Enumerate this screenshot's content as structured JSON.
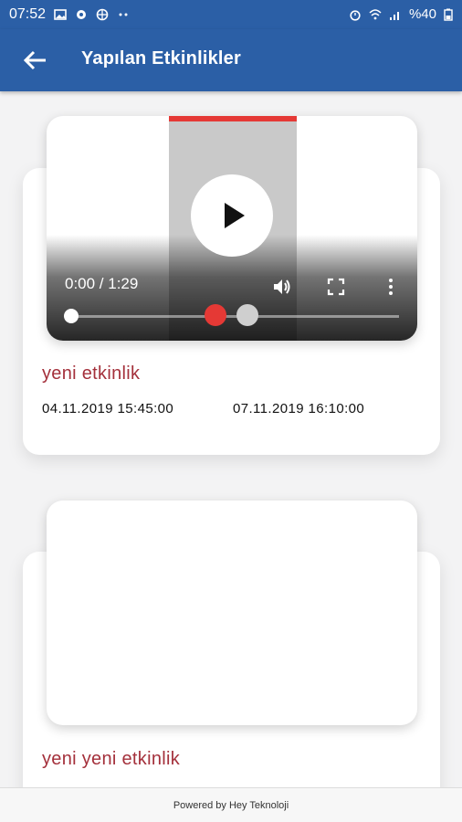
{
  "status_bar": {
    "time": "07:52",
    "battery": "%40",
    "icons_left": [
      "image-icon",
      "notification-icon",
      "globe-icon",
      "more-dots-icon"
    ],
    "icons_right": [
      "alarm-icon",
      "wifi-icon",
      "signal-icon"
    ]
  },
  "app_bar": {
    "title": "Yapılan Etkinlikler",
    "back_icon": "arrow-left-icon"
  },
  "events": [
    {
      "title": "yeni etkinlik",
      "start": "04.11.2019 15:45:00",
      "end": "07.11.2019 16:10:00",
      "video_time": "0:00 / 1:29"
    },
    {
      "title": "yeni yeni etkinlik"
    }
  ],
  "footer": {
    "text": "Powered by Hey Teknoloji"
  },
  "colors": {
    "app_bar": "#2b5fa6",
    "event_title": "#a4303b",
    "progress": "#e53935"
  }
}
